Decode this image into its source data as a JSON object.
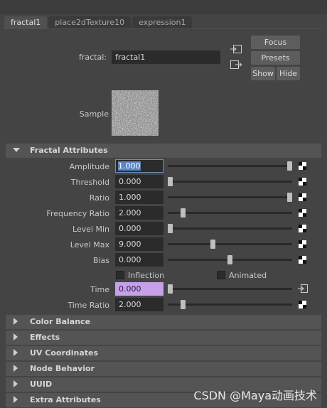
{
  "tabs": [
    "fractal1",
    "place2dTexture10",
    "expression1"
  ],
  "node": {
    "label": "fractal:",
    "value": "fractal1",
    "focus_label": "Focus",
    "presets_label": "Presets",
    "show_label": "Show",
    "hide_label": "Hide",
    "sample_label": "Sample"
  },
  "fractal_section": {
    "title": "Fractal Attributes",
    "attributes": [
      {
        "label": "Amplitude",
        "value": "1.000",
        "slider_fraction": 1.0,
        "state": "selected",
        "map_icon": "checker-map-icon"
      },
      {
        "label": "Threshold",
        "value": "0.000",
        "slider_fraction": 0.0,
        "state": "normal",
        "map_icon": "checker-map-icon"
      },
      {
        "label": "Ratio",
        "value": "1.000",
        "slider_fraction": 1.0,
        "state": "normal",
        "map_icon": "checker-map-icon"
      },
      {
        "label": "Frequency Ratio",
        "value": "2.000",
        "slider_fraction": 0.11,
        "state": "normal",
        "map_icon": "checker-map-icon"
      },
      {
        "label": "Level Min",
        "value": "0.000",
        "slider_fraction": 0.0,
        "state": "normal",
        "map_icon": "checker-map-icon"
      },
      {
        "label": "Level Max",
        "value": "9.000",
        "slider_fraction": 0.36,
        "state": "normal",
        "map_icon": "checker-map-icon"
      },
      {
        "label": "Bias",
        "value": "0.000",
        "slider_fraction": 0.5,
        "state": "normal",
        "map_icon": "checker-map-icon"
      }
    ],
    "inflection_label": "Inflection",
    "animated_label": "Animated",
    "time": {
      "label": "Time",
      "value": "0.000",
      "slider_fraction": 0.0,
      "state": "keyed",
      "map_icon": "input-connection-icon"
    },
    "time_ratio": {
      "label": "Time Ratio",
      "value": "2.000",
      "slider_fraction": 0.11,
      "state": "normal",
      "map_icon": "checker-map-icon"
    }
  },
  "collapsed_sections": [
    "Color Balance",
    "Effects",
    "UV Coordinates",
    "Node Behavior",
    "UUID",
    "Extra Attributes"
  ],
  "watermark": "CSDN @Maya动画技术",
  "colors": {
    "panel": "#444444",
    "field": "#2b2b2b",
    "keyed": "#c6a0e8",
    "selection": "#5b84c4"
  }
}
